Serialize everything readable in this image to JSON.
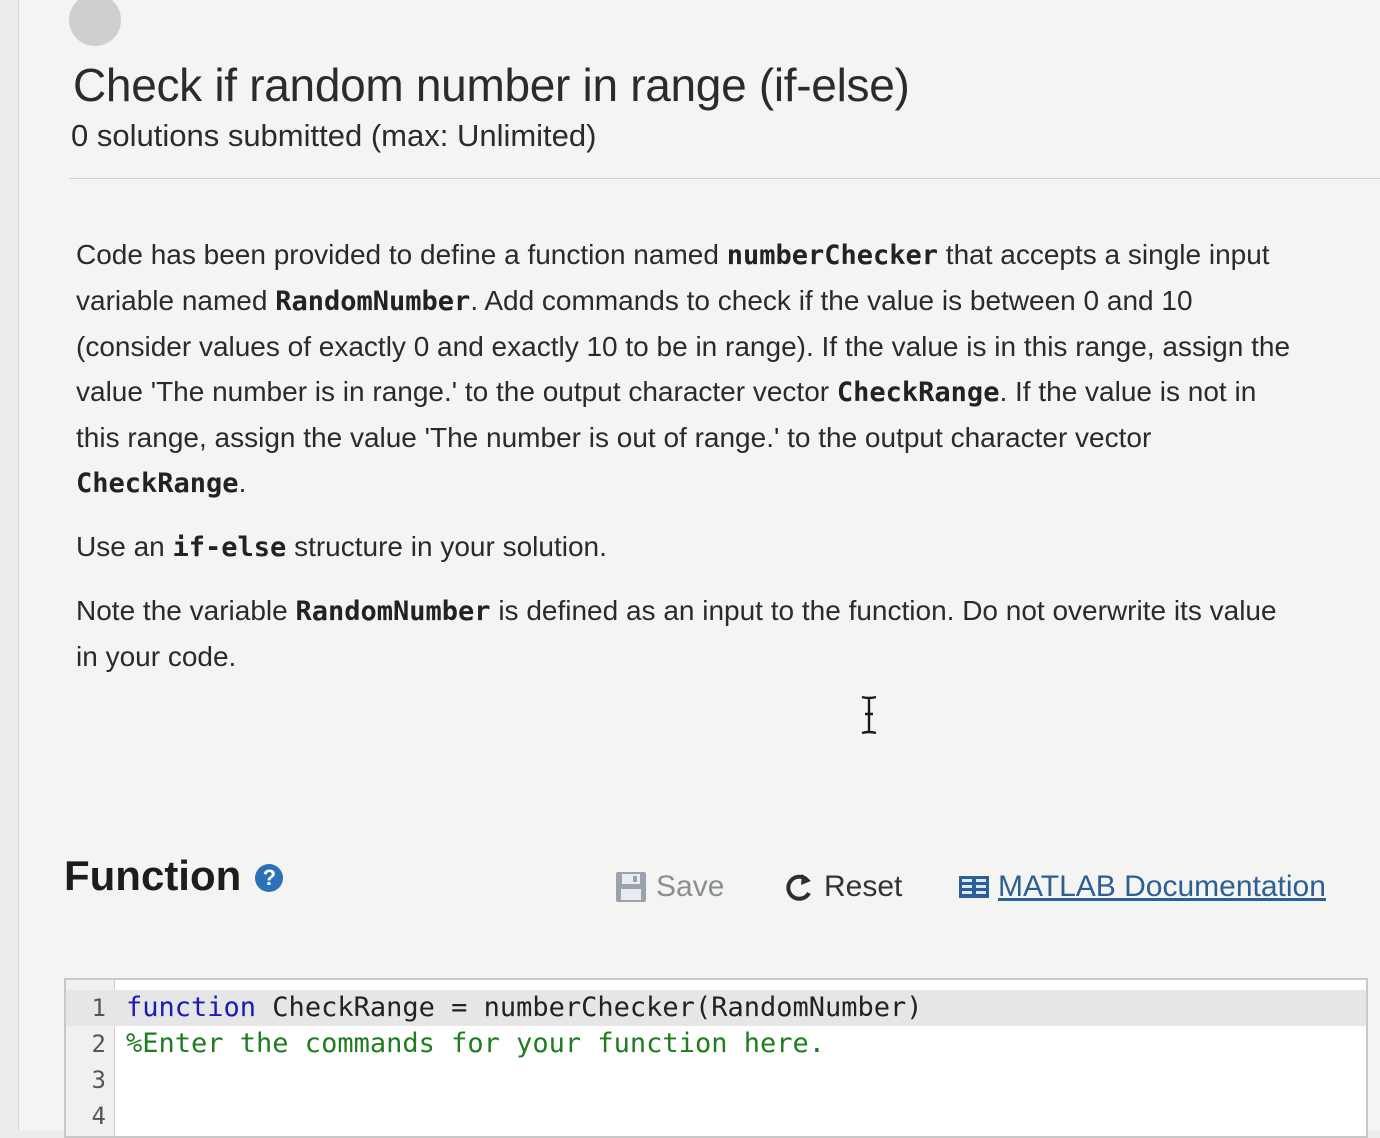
{
  "header": {
    "title": "Check if random number in range (if-else)",
    "subtitle": "0 solutions submitted (max: Unlimited)"
  },
  "description": {
    "p1": [
      {
        "text": "Code has been provided to define a function named ",
        "code": false
      },
      {
        "text": "numberChecker",
        "code": true
      },
      {
        "text": " that accepts a single input variable named ",
        "code": false
      },
      {
        "text": "RandomNumber",
        "code": true
      },
      {
        "text": ". Add commands to check if the value is between 0 and 10 (consider values of exactly 0 and exactly 10 to be in range). If the value is in this range, assign the value 'The number is in range.' to the output character vector ",
        "code": false
      },
      {
        "text": "CheckRange",
        "code": true
      },
      {
        "text": ". If the value is not in this range, assign the value 'The number is out of range.' to the output character vector ",
        "code": false
      },
      {
        "text": "CheckRange",
        "code": true
      },
      {
        "text": ".",
        "code": false
      }
    ],
    "p2": [
      {
        "text": "Use an ",
        "code": false
      },
      {
        "text": "if-else",
        "code": true
      },
      {
        "text": " structure in your solution.",
        "code": false
      }
    ],
    "p3": [
      {
        "text": "Note the variable ",
        "code": false
      },
      {
        "text": "RandomNumber",
        "code": true
      },
      {
        "text": " is defined as an input to the function. Do not overwrite its value in your code.",
        "code": false
      }
    ]
  },
  "function_section": {
    "heading": "Function",
    "help_icon": "question-circle-icon",
    "save_label": "Save",
    "reset_label": "Reset",
    "doc_label": "MATLAB Documentation"
  },
  "editor": {
    "lines": [
      {
        "num": "1",
        "tokens": [
          {
            "t": "function",
            "k": "kw"
          },
          {
            "t": " CheckRange = numberChecker(RandomNumber)",
            "k": "plain"
          }
        ]
      },
      {
        "num": "2",
        "tokens": [
          {
            "t": "%Enter the commands for your function here.",
            "k": "cm"
          }
        ]
      },
      {
        "num": "3",
        "tokens": []
      },
      {
        "num": "4",
        "tokens": []
      }
    ]
  }
}
